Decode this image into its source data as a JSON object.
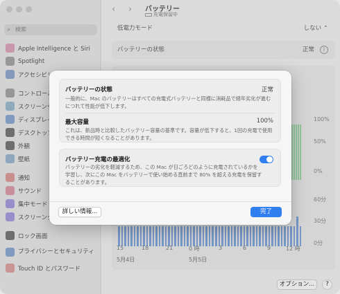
{
  "sidebar": {
    "search_placeholder": "検索",
    "items": [
      {
        "label": "Apple Intelligence と Siri",
        "icon": "siri-icon",
        "color": "#d9a3b8"
      },
      {
        "label": "Spotlight",
        "icon": "spotlight-icon",
        "color": "#a3a3a3"
      },
      {
        "label": "アクセシビリティ",
        "icon": "accessibility-icon",
        "color": "#8ea5c7"
      },
      {
        "label": "コントロールセンター",
        "icon": "control-center-icon",
        "color": "#a3a3a3"
      },
      {
        "label": "スクリーンセーバ",
        "icon": "screensaver-icon",
        "color": "#9ab6cc"
      },
      {
        "label": "ディスプレイ",
        "icon": "display-icon",
        "color": "#8aa6cf"
      },
      {
        "label": "デスクトップとDock",
        "icon": "desktop-dock-icon",
        "color": "#777"
      },
      {
        "label": "外観",
        "icon": "appearance-icon",
        "color": "#777"
      },
      {
        "label": "壁紙",
        "icon": "wallpaper-icon",
        "color": "#9ab4cd"
      },
      {
        "label": "通知",
        "icon": "notifications-icon",
        "color": "#d89a9a"
      },
      {
        "label": "サウンド",
        "icon": "sound-icon",
        "color": "#d89aa6"
      },
      {
        "label": "集中モード",
        "icon": "focus-icon",
        "color": "#a49ad8"
      },
      {
        "label": "スクリーンタイム",
        "icon": "screen-time-icon",
        "color": "#a49ad8"
      },
      {
        "label": "ロック画面",
        "icon": "lock-screen-icon",
        "color": "#777"
      },
      {
        "label": "プライバシーとセキュリティ",
        "icon": "privacy-icon",
        "color": "#8aa6cf"
      },
      {
        "label": "Touch ID とパスワード",
        "icon": "touch-id-icon",
        "color": "#d8a0a0"
      }
    ]
  },
  "header": {
    "back_glyph": "‹",
    "forward_glyph": "›",
    "title": "バッテリー",
    "subtitle": "充電保留中"
  },
  "main": {
    "low_power_label": "低電力モード",
    "low_power_value": "しない",
    "battery_health_label": "バッテリーの状態",
    "battery_health_value": "正常",
    "percent_labels": [
      "100%",
      "50%",
      "0%"
    ],
    "minute_labels": [
      "60分",
      "30分",
      "0分"
    ],
    "time_labels": [
      "15",
      "18",
      "21",
      "0 時",
      "3",
      "6",
      "9",
      "12 時"
    ],
    "date_labels": [
      "5月4日",
      "5月5日"
    ],
    "options_button": "オプション...",
    "help_button": "?"
  },
  "sheet": {
    "health_title": "バッテリーの状態",
    "health_value": "正常",
    "health_desc": "一般的に、Mac のバッテリーはすべての充電式バッテリーと同様に消耗品で経年劣化が進むにつれて性能が低下します。",
    "capacity_title": "最大容量",
    "capacity_value": "100%",
    "capacity_desc": "これは、新品時と比較したバッテリー容量の基準です。容量が低下すると、1回の充電で使用できる時間が短くなることがあります。",
    "optimize_title": "バッテリー充電の最適化",
    "optimize_desc": "バッテリーの劣化を軽減するため、この Mac が日ごろどのように充電されているかを学習し、次にこの Mac をバッテリーで使い始める直前まで 80% を超える充電を保留することがあります。",
    "optimize_enabled": true,
    "more_info_button": "詳しい情報...",
    "done_button": "完了"
  },
  "chart_data": {
    "type": "bar",
    "ylabel": "",
    "ylim": [
      0,
      60
    ],
    "values": [
      27,
      27,
      27,
      27,
      27,
      27,
      27,
      27,
      27,
      27,
      27,
      27,
      27,
      27,
      27,
      27,
      27,
      27,
      27,
      27,
      27,
      27,
      27,
      27,
      27,
      27,
      27,
      27,
      27,
      27,
      27,
      27,
      27,
      27,
      27,
      27,
      27,
      27,
      27,
      27,
      27,
      27,
      27,
      27,
      27,
      27,
      27,
      27,
      27,
      27,
      27,
      27,
      27,
      27,
      27,
      27,
      27,
      40,
      27
    ]
  }
}
